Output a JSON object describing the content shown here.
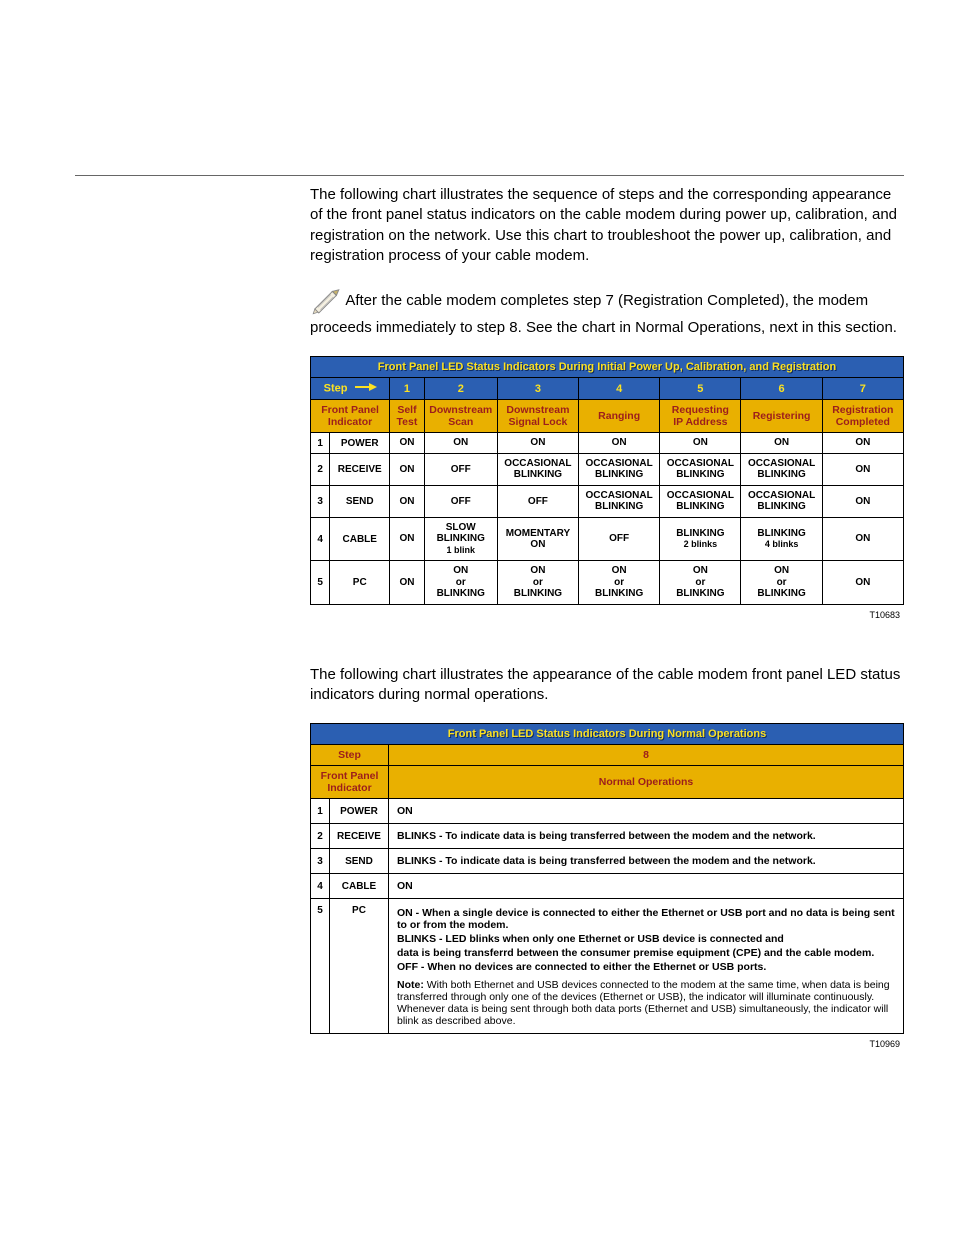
{
  "section1": {
    "title": "Initial Power Up, Calibration, and Registration",
    "intro": "The following chart illustrates the sequence of steps and the corresponding appearance of the front panel status indicators on the cable modem during power up, calibration, and registration on the network. Use this chart to troubleshoot the power up, calibration, and registration process of your cable modem.",
    "note": "After the cable modem completes step 7 (Registration Completed), the modem proceeds immediately to step 8. See the chart in Normal Operations, next in this section."
  },
  "table1": {
    "title": "Front Panel LED Status Indicators During Initial Power Up, Calibration, and Registration",
    "step_label": "Step",
    "fp_label_line1": "Front Panel",
    "fp_label_line2": "Indicator",
    "steps": [
      "1",
      "2",
      "3",
      "4",
      "5",
      "6",
      "7"
    ],
    "phases": [
      "Self\nTest",
      "Downstream\nScan",
      "Downstream\nSignal Lock",
      "Ranging",
      "Requesting\nIP Address",
      "Registering",
      "Registration\nCompleted"
    ],
    "rows": [
      {
        "n": "1",
        "name": "POWER",
        "cells": [
          "ON",
          "ON",
          "ON",
          "ON",
          "ON",
          "ON",
          "ON"
        ]
      },
      {
        "n": "2",
        "name": "RECEIVE",
        "cells": [
          "ON",
          "OFF",
          "OCCASIONAL\nBLINKING",
          "OCCASIONAL\nBLINKING",
          "OCCASIONAL\nBLINKING",
          "OCCASIONAL\nBLINKING",
          "ON"
        ]
      },
      {
        "n": "3",
        "name": "SEND",
        "cells": [
          "ON",
          "OFF",
          "OFF",
          "OCCASIONAL\nBLINKING",
          "OCCASIONAL\nBLINKING",
          "OCCASIONAL\nBLINKING",
          "ON"
        ]
      },
      {
        "n": "4",
        "name": "CABLE",
        "cells": [
          "ON",
          "SLOW\nBLINKING\n_sub_1 blink",
          "MOMENTARY\nON",
          "OFF",
          "BLINKING\n_sub_2 blinks",
          "BLINKING\n_sub_4 blinks",
          "ON"
        ]
      },
      {
        "n": "5",
        "name": "PC",
        "cells": [
          "ON",
          "ON\nor\nBLINKING",
          "ON\nor\nBLINKING",
          "ON\nor\nBLINKING",
          "ON\nor\nBLINKING",
          "ON\nor\nBLINKING",
          "ON"
        ]
      }
    ],
    "ref": "T10683"
  },
  "section2": {
    "title": "Normal Operations",
    "intro": "The following chart illustrates the appearance of the cable modem front panel LED status indicators during normal operations."
  },
  "table2": {
    "title": "Front Panel LED Status Indicators During Normal Operations",
    "step_label": "Step",
    "step_value": "8",
    "fp_label_line1": "Front Panel",
    "fp_label_line2": "Indicator",
    "phase": "Normal Operations",
    "rows": [
      {
        "n": "1",
        "name": "POWER",
        "desc": "ON"
      },
      {
        "n": "2",
        "name": "RECEIVE",
        "desc": "BLINKS - To indicate data is being transferred between the modem and the network."
      },
      {
        "n": "3",
        "name": "SEND",
        "desc": "BLINKS - To indicate data is being transferred between the modem and the network."
      },
      {
        "n": "4",
        "name": "CABLE",
        "desc": "ON"
      }
    ],
    "pc": {
      "n": "5",
      "name": "PC",
      "on": "ON - When a single device is connected to either the Ethernet or USB port and no data is being sent to or from the modem.",
      "blinks1": "BLINKS - LED blinks when only one Ethernet or USB device is connected and",
      "blinks2": "data is being transferrd between the consumer premise equipment (CPE) and the cable modem.",
      "off": "OFF - When no devices are connected to either the Ethernet or USB ports.",
      "note_label": "Note:",
      "note": "With both Ethernet and USB devices connected to the modem at the same time, when data is being transferred through only one of the devices (Ethernet or USB), the indicator will illuminate continuously. Whenever data is being sent through both data ports (Ethernet and USB) simultaneously, the indicator will blink as described above."
    },
    "ref": "T10969"
  }
}
